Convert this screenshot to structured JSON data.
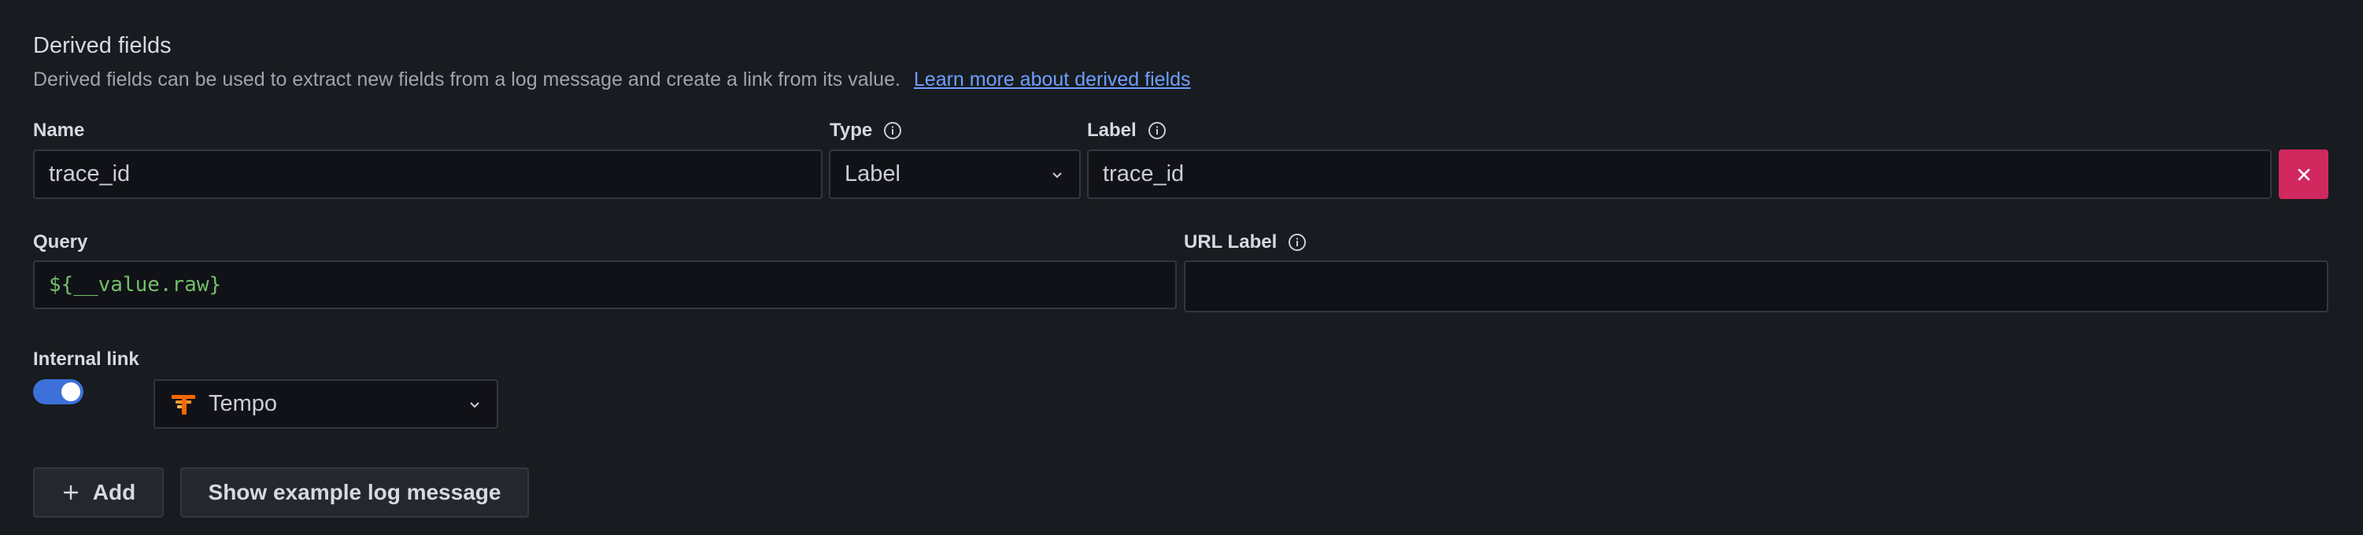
{
  "section": {
    "title": "Derived fields",
    "description": "Derived fields can be used to extract new fields from a log message and create a link from its value.",
    "learn_more": "Learn more about derived fields"
  },
  "fields": {
    "name_label": "Name",
    "name_value": "trace_id",
    "type_label": "Type",
    "type_value": "Label",
    "label_label": "Label",
    "label_value": "trace_id",
    "query_label": "Query",
    "query_value": "${__value.raw}",
    "url_label_label": "URL Label",
    "url_label_value": ""
  },
  "internal_link": {
    "label": "Internal link",
    "enabled": true,
    "datasource": "Tempo"
  },
  "actions": {
    "add_label": "Add",
    "show_example_label": "Show example log message"
  },
  "colors": {
    "background": "#181b1f",
    "input_bg": "#111217",
    "remove_button": "#d1285f",
    "toggle_on": "#3d71d9",
    "link": "#6e9fff",
    "query_text": "#73bf69"
  },
  "icons": {
    "info": "info-circle-icon",
    "chevron": "chevron-down-icon",
    "remove": "close-icon",
    "add": "plus-icon",
    "datasource": "tempo-logo-icon"
  }
}
